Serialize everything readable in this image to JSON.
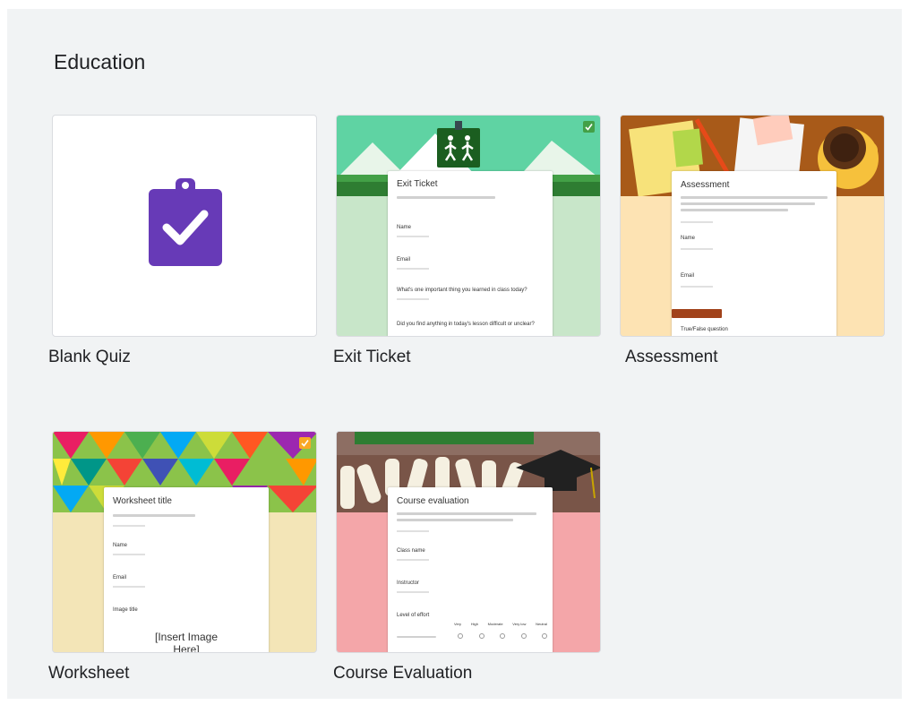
{
  "section": {
    "title": "Education"
  },
  "templates": [
    {
      "label": "Blank Quiz"
    },
    {
      "label": "Exit Ticket",
      "form_title": "Exit Ticket",
      "fields": [
        "Name",
        "Email",
        "What's one important thing you learned in class today?",
        "Did you find anything in today's lesson difficult or unclear?"
      ]
    },
    {
      "label": "Assessment",
      "form_title": "Assessment",
      "fields": [
        "Name",
        "Email",
        "True/False question"
      ]
    },
    {
      "label": "Worksheet",
      "form_title": "Worksheet title",
      "fields": [
        "Name",
        "Email",
        "Image title"
      ],
      "image_placeholder": "[Insert Image Here]"
    },
    {
      "label": "Course Evaluation",
      "form_title": "Course evaluation",
      "fields": [
        "Class name",
        "Instructor",
        "Level of effort"
      ],
      "scale": [
        "Very",
        "High",
        "Moderate",
        "Very low",
        "Neutral"
      ]
    }
  ],
  "colors": {
    "background": "#f1f3f4",
    "quiz_purple": "#673ab7",
    "exit_green": "#c8e6c9",
    "assessment_tan": "#fde3b3",
    "assessment_brown": "#a1421a",
    "worksheet_beige": "#f3e5b7",
    "evaluation_pink": "#f4a6a9"
  }
}
